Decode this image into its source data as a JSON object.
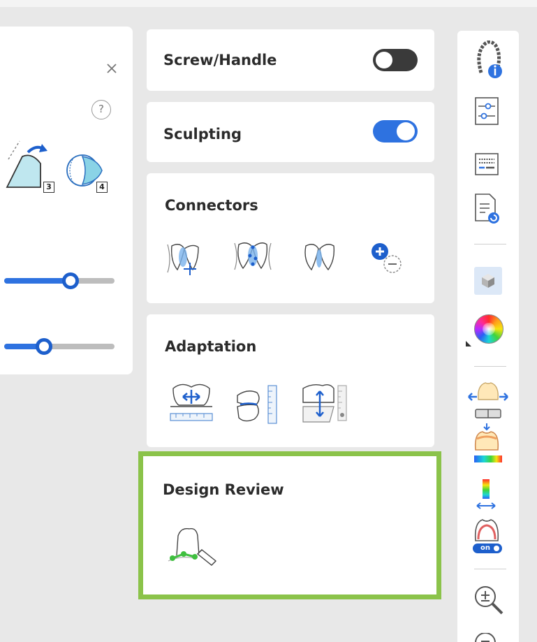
{
  "left_panel": {
    "close_icon": "close-icon",
    "help_label": "?",
    "tools": [
      {
        "icon": "rotate-tooth-icon",
        "badge": "3"
      },
      {
        "icon": "sphere-tooth-icon",
        "badge": "4"
      }
    ],
    "sliders": [
      {
        "name": "slider-1",
        "value": 0.6
      },
      {
        "name": "slider-2",
        "value": 0.36
      }
    ]
  },
  "cards": {
    "screw_handle": {
      "title": "Screw/Handle",
      "toggle_on": false
    },
    "sculpting": {
      "title": "Sculpting",
      "toggle_on": true
    },
    "connectors": {
      "title": "Connectors",
      "tools": [
        "connector-move-icon",
        "connector-edit-icon",
        "connector-simple-icon",
        "connector-add-remove-icon"
      ]
    },
    "adaptation": {
      "title": "Adaptation",
      "tools": [
        "adaptation-horizontal-icon",
        "adaptation-vertical-icon",
        "adaptation-gap-icon"
      ]
    },
    "design_review": {
      "title": "Design Review",
      "tools": [
        "margin-line-pen-icon"
      ]
    }
  },
  "right_toolbar": {
    "items": [
      "arch-info-icon",
      "sliders-settings-icon",
      "keyboard-icon",
      "document-refresh-icon",
      "cube-view-icon",
      "color-wheel-icon",
      "tooth-expand-icon",
      "tooth-heatmap-icon",
      "color-scale-icon",
      "tooth-on-toggle-icon",
      "zoom-in-icon",
      "zoom-fit-icon"
    ],
    "toggle_label": "on",
    "accent": "#2e72e0"
  },
  "colors": {
    "accent": "#2e72e0",
    "highlight_border": "#8bc34a",
    "toggle_off": "#3a3a3a"
  }
}
